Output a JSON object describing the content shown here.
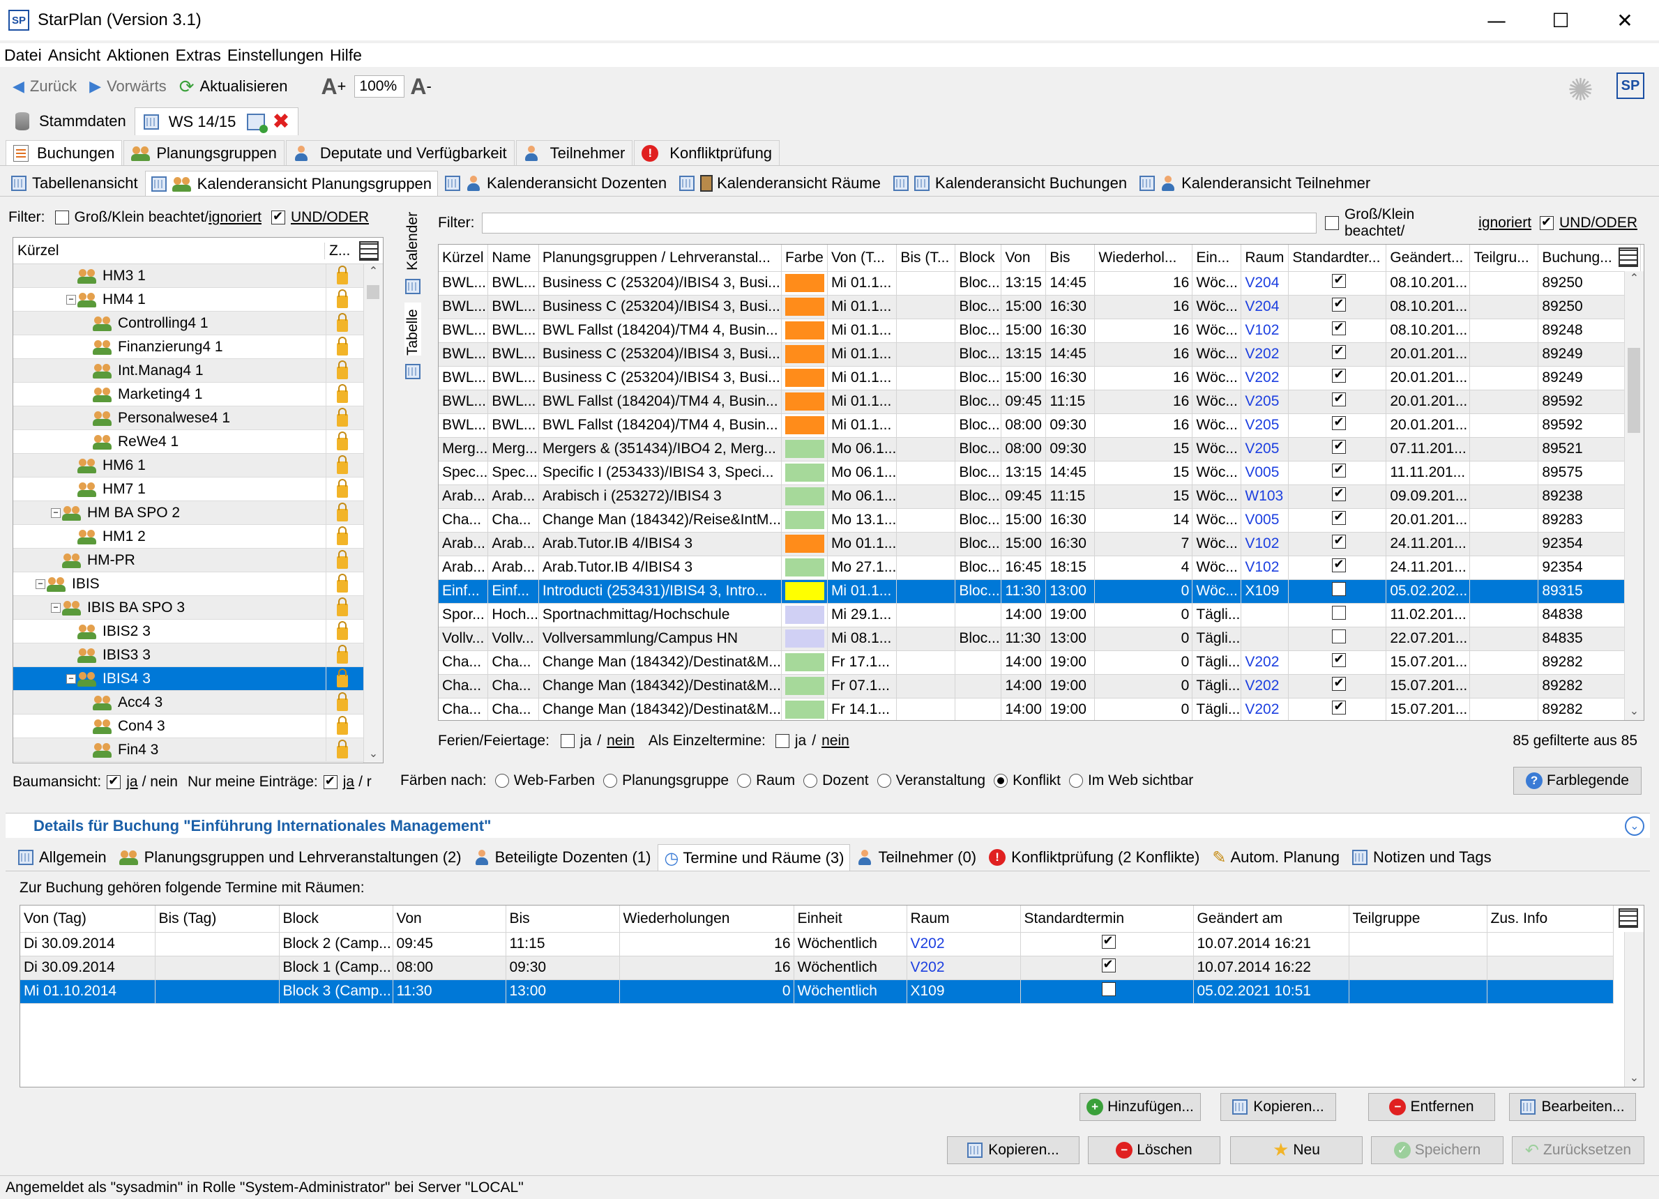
{
  "window": {
    "title": "StarPlan (Version 3.1)",
    "icon_label": "SP"
  },
  "menu": [
    "Datei",
    "Ansicht",
    "Aktionen",
    "Extras",
    "Einstellungen",
    "Hilfe"
  ],
  "toolbar": {
    "back": "Zurück",
    "forward": "Vorwärts",
    "refresh": "Aktualisieren",
    "zoom_in": "+",
    "zoom": "100%",
    "zoom_out": "-"
  },
  "stamm_tabs": {
    "stammdaten": "Stammdaten",
    "semester": "WS 14/15"
  },
  "main_tabs": [
    "Buchungen",
    "Planungsgruppen",
    "Deputate und Verfügbarkeit",
    "Teilnehmer",
    "Konfliktprüfung"
  ],
  "view_tabs": [
    "Tabellenansicht",
    "Kalenderansicht Planungsgruppen",
    "Kalenderansicht Dozenten",
    "Kalenderansicht Räume",
    "Kalenderansicht Buchungen",
    "Kalenderansicht Teilnehmer"
  ],
  "left_filter": {
    "label": "Filter:",
    "case_a": "Groß/Klein beachtet/",
    "case_b": "ignoriert",
    "undoder": "UND/ODER"
  },
  "tree": {
    "col_kuerzel": "Kürzel",
    "col_z": "Z...",
    "rows": [
      {
        "label": "HM3 1",
        "indent": 3,
        "exp": ""
      },
      {
        "label": "HM4 1",
        "indent": 3,
        "exp": "−"
      },
      {
        "label": "Controlling4 1",
        "indent": 4,
        "exp": ""
      },
      {
        "label": "Finanzierung4 1",
        "indent": 4,
        "exp": ""
      },
      {
        "label": "Int.Manag4 1",
        "indent": 4,
        "exp": ""
      },
      {
        "label": "Marketing4 1",
        "indent": 4,
        "exp": ""
      },
      {
        "label": "Personalwese4 1",
        "indent": 4,
        "exp": ""
      },
      {
        "label": "ReWe4 1",
        "indent": 4,
        "exp": ""
      },
      {
        "label": "HM6 1",
        "indent": 3,
        "exp": ""
      },
      {
        "label": "HM7 1",
        "indent": 3,
        "exp": ""
      },
      {
        "label": "HM BA SPO 2",
        "indent": 2,
        "exp": "−"
      },
      {
        "label": "HM1 2",
        "indent": 3,
        "exp": ""
      },
      {
        "label": "HM-PR",
        "indent": 2,
        "exp": ""
      },
      {
        "label": "IBIS",
        "indent": 1,
        "exp": "−"
      },
      {
        "label": "IBIS BA SPO 3",
        "indent": 2,
        "exp": "−"
      },
      {
        "label": "IBIS2 3",
        "indent": 3,
        "exp": ""
      },
      {
        "label": "IBIS3 3",
        "indent": 3,
        "exp": ""
      },
      {
        "label": "IBIS4 3",
        "indent": 3,
        "exp": "−",
        "selected": true
      },
      {
        "label": "Acc4 3",
        "indent": 4,
        "exp": ""
      },
      {
        "label": "Con4 3",
        "indent": 4,
        "exp": ""
      },
      {
        "label": "Fin4 3",
        "indent": 4,
        "exp": ""
      }
    ]
  },
  "tree_footer": {
    "baum": "Baumansicht:",
    "ja": "ja",
    "nein": "/ nein",
    "meine": "Nur meine Einträge:",
    "ja2": "ja",
    "r": "/ r"
  },
  "side_tabs": {
    "kalender": "Kalender",
    "tabelle": "Tabelle"
  },
  "right_filter": {
    "label": "Filter:",
    "case_a": "Groß/Klein beachtet/",
    "case_b": "ignoriert",
    "undoder": "UND/ODER"
  },
  "grid": {
    "headers": [
      "Kürzel",
      "Name",
      "Planungsgruppen / Lehrveranstal...",
      "Farbe",
      "Von (T...",
      "Bis (T...",
      "Block",
      "Von",
      "Bis",
      "Wiederhol...",
      "Ein...",
      "Raum",
      "Standardter...",
      "Geändert...",
      "Teilgru...",
      "Buchung..."
    ],
    "rows": [
      [
        "BWL...",
        "BWL...",
        "Business C (253204)/IBIS4 3, Busi...",
        "#ff8c1a",
        "Mi 01.1...",
        "",
        "Bloc...",
        "13:15",
        "14:45",
        "16",
        "Wöc...",
        "V204",
        "on",
        "08.10.201...",
        "",
        "89250"
      ],
      [
        "BWL...",
        "BWL...",
        "Business C (253204)/IBIS4 3, Busi...",
        "#ff8c1a",
        "Mi 01.1...",
        "",
        "Bloc...",
        "15:00",
        "16:30",
        "16",
        "Wöc...",
        "V204",
        "on",
        "08.10.201...",
        "",
        "89250"
      ],
      [
        "BWL...",
        "BWL...",
        "BWL Fallst (184204)/TM4 4, Busin...",
        "#ff8c1a",
        "Mi 01.1...",
        "",
        "Bloc...",
        "15:00",
        "16:30",
        "16",
        "Wöc...",
        "V102",
        "on",
        "08.10.201...",
        "",
        "89248"
      ],
      [
        "BWL...",
        "BWL...",
        "Business C (253204)/IBIS4 3, Busi...",
        "#ff8c1a",
        "Mi 01.1...",
        "",
        "Bloc...",
        "13:15",
        "14:45",
        "16",
        "Wöc...",
        "V202",
        "on",
        "20.01.201...",
        "",
        "89249"
      ],
      [
        "BWL...",
        "BWL...",
        "Business C (253204)/IBIS4 3, Busi...",
        "#ff8c1a",
        "Mi 01.1...",
        "",
        "Bloc...",
        "15:00",
        "16:30",
        "16",
        "Wöc...",
        "V202",
        "on",
        "20.01.201...",
        "",
        "89249"
      ],
      [
        "BWL...",
        "BWL...",
        "BWL Fallst (184204)/TM4 4, Busin...",
        "#ff8c1a",
        "Mi 01.1...",
        "",
        "Bloc...",
        "09:45",
        "11:15",
        "16",
        "Wöc...",
        "V205",
        "on",
        "20.01.201...",
        "",
        "89592"
      ],
      [
        "BWL...",
        "BWL...",
        "BWL Fallst (184204)/TM4 4, Busin...",
        "#ff8c1a",
        "Mi 01.1...",
        "",
        "Bloc...",
        "08:00",
        "09:30",
        "16",
        "Wöc...",
        "V205",
        "on",
        "20.01.201...",
        "",
        "89592"
      ],
      [
        "Merg...",
        "Merg...",
        "Mergers & (351434)/IBO4 2, Merg...",
        "#a6d99a",
        "Mo 06.1...",
        "",
        "Bloc...",
        "08:00",
        "09:30",
        "15",
        "Wöc...",
        "V205",
        "on",
        "07.11.201...",
        "",
        "89521"
      ],
      [
        "Spec...",
        "Spec...",
        "Specific I (253433)/IBIS4 3, Speci...",
        "#a6d99a",
        "Mo 06.1...",
        "",
        "Bloc...",
        "13:15",
        "14:45",
        "15",
        "Wöc...",
        "V005",
        "on",
        "11.11.201...",
        "",
        "89575"
      ],
      [
        "Arab...",
        "Arab...",
        "Arabisch i (253272)/IBIS4 3",
        "#a6d99a",
        "Mo 06.1...",
        "",
        "Bloc...",
        "09:45",
        "11:15",
        "15",
        "Wöc...",
        "W103",
        "on",
        "09.09.201...",
        "",
        "89238"
      ],
      [
        "Cha...",
        "Cha...",
        "Change Man (184342)/Reise&IntM...",
        "#a6d99a",
        "Mo 13.1...",
        "",
        "Bloc...",
        "15:00",
        "16:30",
        "14",
        "Wöc...",
        "V005",
        "on",
        "20.01.201...",
        "",
        "89283"
      ],
      [
        "Arab...",
        "Arab...",
        "Arab.Tutor.IB 4/IBIS4 3",
        "#ff8c1a",
        "Mo 01.1...",
        "",
        "Bloc...",
        "15:00",
        "16:30",
        "7",
        "Wöc...",
        "V102",
        "on",
        "24.11.201...",
        "",
        "92354"
      ],
      [
        "Arab...",
        "Arab...",
        "Arab.Tutor.IB 4/IBIS4 3",
        "#a6d99a",
        "Mo 27.1...",
        "",
        "Bloc...",
        "16:45",
        "18:15",
        "4",
        "Wöc...",
        "V102",
        "on",
        "24.11.201...",
        "",
        "92354"
      ],
      [
        "Einf...",
        "Einf...",
        "Introducti (253431)/IBIS4 3, Intro...",
        "#ffff00",
        "Mi 01.1...",
        "",
        "Bloc...",
        "11:30",
        "13:00",
        "0",
        "Wöc...",
        "X109",
        "off",
        "05.02.202...",
        "",
        "89315"
      ],
      [
        "Spor...",
        "Hoch...",
        "Sportnachmittag/Hochschule",
        "#d0d0f4",
        "Mi 29.1...",
        "",
        "",
        "14:00",
        "19:00",
        "0",
        "Tägli...",
        "",
        "off",
        "11.02.201...",
        "",
        "84838"
      ],
      [
        "Vollv...",
        "Vollv...",
        "Vollversammlung/Campus HN",
        "#d0d0f4",
        "Mi 08.1...",
        "",
        "Bloc...",
        "11:30",
        "13:00",
        "0",
        "Tägli...",
        "",
        "off",
        "22.07.201...",
        "",
        "84835"
      ],
      [
        "Cha...",
        "Cha...",
        "Change Man (184342)/Destinat&M...",
        "#a6d99a",
        "Fr 17.1...",
        "",
        "",
        "14:00",
        "19:00",
        "0",
        "Tägli...",
        "V202",
        "on",
        "15.07.201...",
        "",
        "89282"
      ],
      [
        "Cha...",
        "Cha...",
        "Change Man (184342)/Destinat&M...",
        "#a6d99a",
        "Fr 07.1...",
        "",
        "",
        "14:00",
        "19:00",
        "0",
        "Tägli...",
        "V202",
        "on",
        "15.07.201...",
        "",
        "89282"
      ],
      [
        "Cha...",
        "Cha...",
        "Change Man (184342)/Destinat&M...",
        "#a6d99a",
        "Fr 14.1...",
        "",
        "",
        "14:00",
        "19:00",
        "0",
        "Tägli...",
        "V202",
        "on",
        "15.07.201...",
        "",
        "89282"
      ]
    ],
    "selected_row": 13
  },
  "grid_footer": {
    "ferien": "Ferien/Feiertage:",
    "ja": "ja",
    "sep": "/",
    "nein": "nein",
    "einzel": "Als Einzeltermine:",
    "count": "85 gefilterte aus 85"
  },
  "faerben": {
    "label": "Färben nach:",
    "options": [
      "Web-Farben",
      "Planungsgruppe",
      "Raum",
      "Dozent",
      "Veranstaltung",
      "Konflikt",
      "Im Web sichtbar"
    ],
    "selected": 5,
    "legend": "Farblegende"
  },
  "details": {
    "title": "Details für Buchung \"Einführung Internationales Management\"",
    "tabs": [
      "Allgemein",
      "Planungsgruppen und Lehrveranstaltungen (2)",
      "Beteiligte Dozenten (1)",
      "Termine und Räume (3)",
      "Teilnehmer (0)",
      "Konfliktprüfung (2 Konflikte)",
      "Autom. Planung",
      "Notizen und Tags"
    ],
    "active_tab": 3,
    "label": "Zur Buchung gehören folgende Termine mit Räumen:",
    "headers": [
      "Von (Tag)",
      "Bis (Tag)",
      "Block",
      "Von",
      "Bis",
      "Wiederholungen",
      "Einheit",
      "Raum",
      "Standardtermin",
      "Geändert am",
      "Teilgruppe",
      "Zus. Info"
    ],
    "rows": [
      [
        "Di 30.09.2014",
        "",
        "Block 2 (Camp...",
        "09:45",
        "11:15",
        "16",
        "Wöchentlich",
        "V202",
        "on",
        "10.07.2014 16:21",
        "",
        ""
      ],
      [
        "Di 30.09.2014",
        "",
        "Block 1 (Camp...",
        "08:00",
        "09:30",
        "16",
        "Wöchentlich",
        "V202",
        "on",
        "10.07.2014 16:22",
        "",
        ""
      ],
      [
        "Mi 01.10.2014",
        "",
        "Block 3 (Camp...",
        "11:30",
        "13:00",
        "0",
        "Wöchentlich",
        "X109",
        "off",
        "05.02.2021 10:51",
        "",
        ""
      ]
    ],
    "selected_row": 2
  },
  "buttons": {
    "hinzufuegen": "Hinzufügen...",
    "kopieren_t": "Kopieren...",
    "entfernen": "Entfernen",
    "bearbeiten": "Bearbeiten...",
    "kopieren": "Kopieren...",
    "loeschen": "Löschen",
    "neu": "Neu",
    "speichern": "Speichern",
    "zuruecksetzen": "Zurücksetzen"
  },
  "status": "Angemeldet als \"sysadmin\" in Rolle \"System-Administrator\" bei Server \"LOCAL\"",
  "colors": {
    "selection": "#0078d7",
    "link": "#1c3fe0",
    "details_title": "#1a5fa8"
  }
}
